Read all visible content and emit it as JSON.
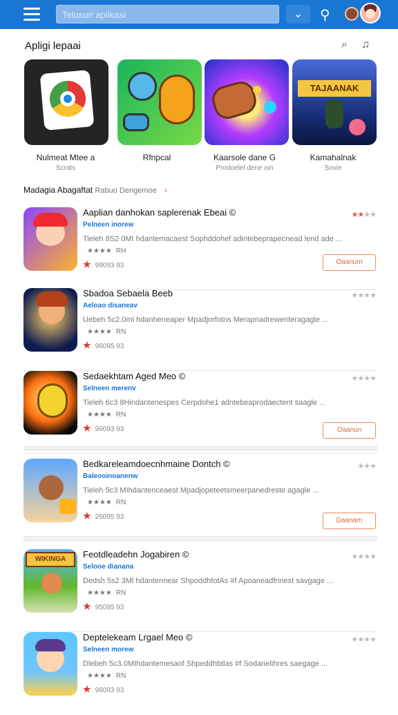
{
  "topbar": {
    "search_text": "Telusuri aplikasi",
    "menu_icon": "menu-icon",
    "down_icon": "download-icon",
    "filter_icon": "filter-icon",
    "profile_icon": "profile-avatar"
  },
  "header": {
    "title": "Apligi lepaai",
    "search_icon": "search-icon",
    "bell_icon": "notification-icon"
  },
  "featured": [
    {
      "name": "Nulmeat Mtee a",
      "sub": "Scrats"
    },
    {
      "name": "Rfnpcal",
      "sub": ""
    },
    {
      "name": "Kaarsole dane G",
      "sub": "Prodoelel dene oin"
    },
    {
      "name": "Kamahalnak",
      "sub": "Sovie"
    }
  ],
  "section": {
    "title": "Madagia Abagaftat",
    "subtitle": "Rabuo Dengemoe",
    "arrow": "›"
  },
  "apps": [
    {
      "title": "Aaplian danhokan saplerenak Ebeai ©",
      "dev": "Pelneen inorew",
      "desc": "Tieleh 8S2 0MI hdantemacaest Sophddohef adintebeprapecnead lend ade ...",
      "stars": "★★★★",
      "rating": "RH",
      "count": "99093 93",
      "small": "★★★",
      "button": "Oaanum"
    },
    {
      "title": "Sbadoa Sebaela Beeb",
      "dev": "Aeloao disaneav",
      "desc": "Uebeh 5c2.0ml hdanheneaper Mpadjorfotns Merapnadrewenteragagle ...",
      "stars": "★★★★",
      "rating": "RN",
      "count": "96095 93",
      "small": "★★★★",
      "button": ""
    },
    {
      "title": "Sedaekhtam Aged Meo ©",
      "dev": "Selneen merenv",
      "desc": "Tieleh 6c3 8Hindantenespes Cerpdohe1 adntebeaprodaectent saagle ...",
      "stars": "★★★★",
      "rating": "RN",
      "count": "96093 93",
      "small": "★★★★",
      "button": "Oaanun"
    },
    {
      "title": "Bedkareleamdoecnhmaine Dontch ©",
      "dev": "Baleooinoanenw",
      "desc": "Tieleh 5c3 MIhdantenceaest Mpadjopeteetsmeerpanedreste agagle ...",
      "stars": "★★★★",
      "rating": "RN",
      "count": "26095 93",
      "small": "★★★",
      "button": "Daanam"
    },
    {
      "title": "Feotdleadehn Jogabiren ©",
      "dev": "Selooe dianana",
      "desc": "Dedsh 5s2 3Ml hdantennear ShpoddhfotAs #f Apoaneadfrinest savgage ...",
      "stars": "★★★★",
      "rating": "RN",
      "count": "95095 93",
      "small": "★★★★",
      "button": ""
    },
    {
      "title": "Deptelekeam Lrgael Meo ©",
      "dev": "Selneen morew",
      "desc": "Dlebeh 5c3.0MIhdantemesaof Shpeddhbtlas #f Sodanelihres saegage ...",
      "stars": "★★★★",
      "rating": "RN",
      "count": "96093 93",
      "small": "★★★★",
      "button": ""
    }
  ],
  "colors": {
    "topbar": "#1976d2",
    "accent": "#e6895b",
    "star": "#f5b400"
  }
}
